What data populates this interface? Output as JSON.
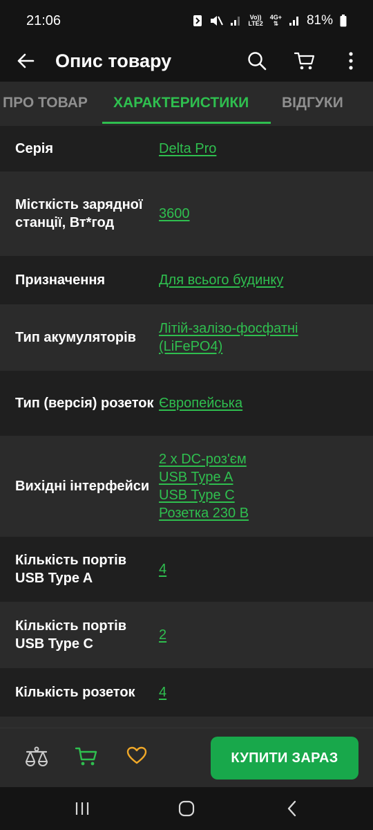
{
  "status_bar": {
    "time": "21:06",
    "net_top": "Vo))",
    "net_bottom": "LTE2",
    "net_type": "4G+",
    "battery": "81%"
  },
  "app_bar": {
    "title": "Опис товару"
  },
  "tabs": [
    {
      "label": "ПРО ТОВАР",
      "active": false
    },
    {
      "label": "ХАРАКТЕРИСТИКИ",
      "active": true
    },
    {
      "label": "ВІДГУКИ",
      "active": false
    }
  ],
  "specs": [
    {
      "label": "Серія",
      "values": [
        "Delta Pro"
      ]
    },
    {
      "label": "Місткість зарядної станції, Вт*год",
      "values": [
        "3600"
      ]
    },
    {
      "label": "Призначення",
      "values": [
        "Для всього будинку"
      ]
    },
    {
      "label": "Тип акумуляторів",
      "values": [
        "Літій-залізо-фосфатні (LiFePO4)"
      ]
    },
    {
      "label": "Тип (версія) розеток",
      "values": [
        "Європейська"
      ]
    },
    {
      "label": "Вихідні інтерфейси",
      "values": [
        "2 x DC-роз'єм",
        "USB Type A",
        "USB Type C",
        "Розетка 230 В"
      ]
    },
    {
      "label": "Кількість портів USB Type A",
      "values": [
        "4"
      ]
    },
    {
      "label": "Кількість портів USB Type C",
      "values": [
        "2"
      ]
    },
    {
      "label": "Кількість розеток",
      "values": [
        "4"
      ]
    }
  ],
  "bottom_bar": {
    "buy_label": "КУПИТИ ЗАРАЗ"
  },
  "colors": {
    "accent": "#2fbf4f",
    "buy_button": "#18a84b",
    "favorite": "#f0a828"
  },
  "icons": [
    "back-arrow-icon",
    "search-icon",
    "cart-icon",
    "more-vert-icon",
    "compare-scales-icon",
    "heart-icon",
    "recents-icon",
    "home-icon",
    "nav-back-icon"
  ]
}
